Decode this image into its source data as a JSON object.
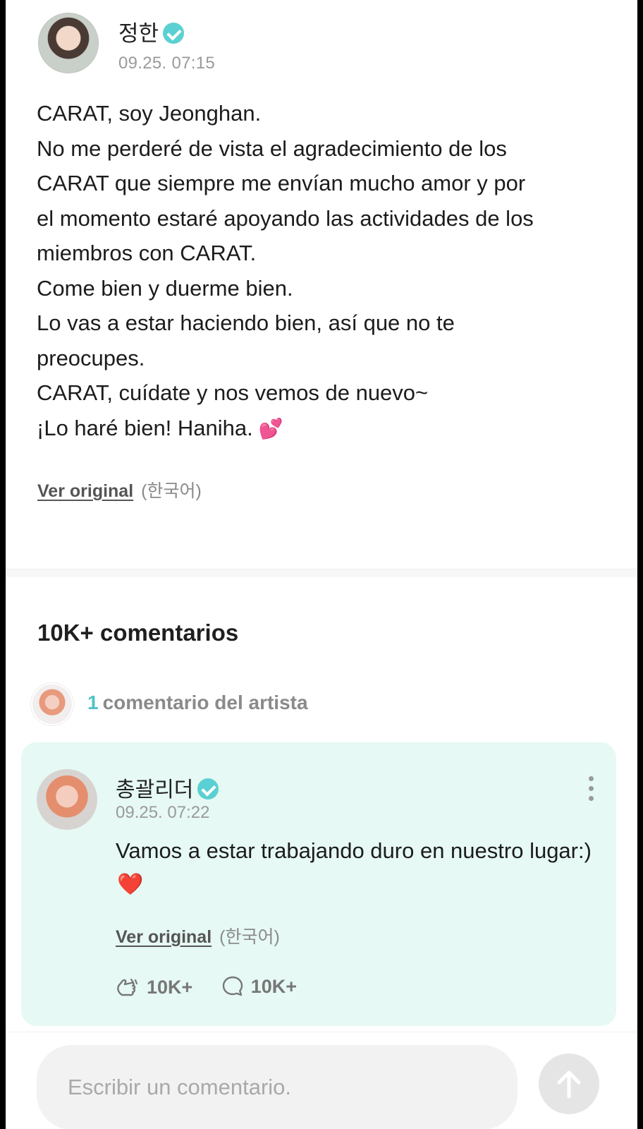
{
  "post": {
    "author": "정한",
    "timestamp": "09.25. 07:15",
    "lines": [
      "CARAT, soy Jeonghan.",
      "No me perderé de vista el agradecimiento de los",
      "CARAT que siempre me envían mucho amor y por",
      "el momento estaré apoyando las actividades de los",
      "miembros con CARAT.",
      "Come bien y duerme bien.",
      "Lo vas a estar haciendo bien, así que no te",
      "preocupes.",
      "CARAT, cuídate y nos vemos de nuevo~",
      "¡Lo haré bien! Haniha."
    ],
    "emoji": "💕",
    "see_original": "Ver original",
    "original_lang": "(한국어)"
  },
  "comments": {
    "count_label": "10K+ comentarios",
    "artist_count": "1",
    "artist_label": "comentario del artista"
  },
  "artist_comment": {
    "author": "총괄리더",
    "timestamp": "09.25. 07:22",
    "text": "Vamos a estar trabajando duro en nuestro lugar:)",
    "emoji": "❤️",
    "see_original": "Ver original",
    "original_lang": "(한국어)",
    "likes": "10K+",
    "replies": "10K+"
  },
  "composer": {
    "placeholder": "Escribir un comentario."
  },
  "colors": {
    "verified": "#5bd0d2",
    "artist_card_bg": "#e6f9f4",
    "accent": "#4fc3c6"
  }
}
